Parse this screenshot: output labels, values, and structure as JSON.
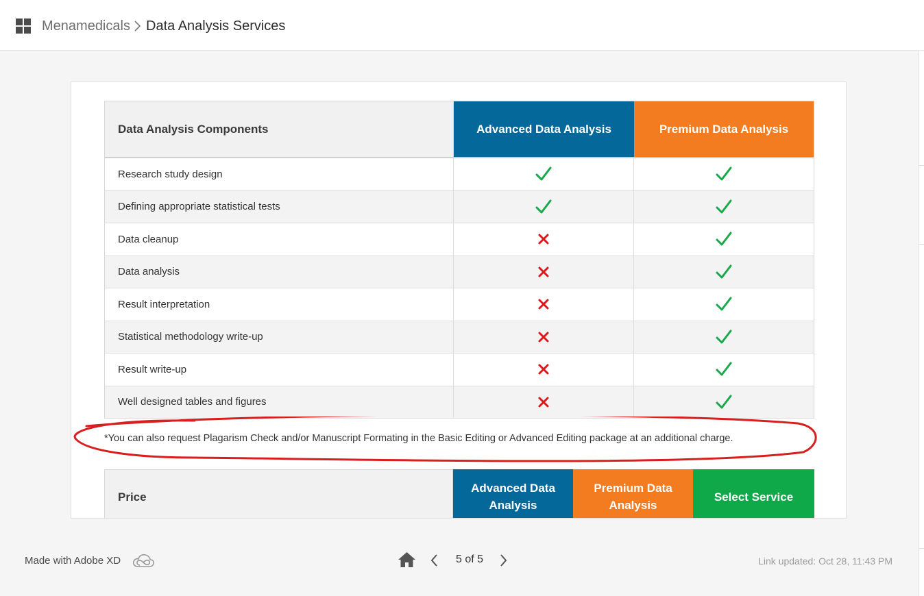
{
  "header": {
    "breadcrumb_root": "Menamedicals",
    "breadcrumb_current": "Data Analysis Services"
  },
  "comparison": {
    "header": {
      "components": "Data Analysis Components",
      "advanced": "Advanced Data Analysis",
      "premium": "Premium Data Analysis"
    },
    "rows": [
      {
        "label": "Research study design",
        "advanced": true,
        "premium": true
      },
      {
        "label": "Defining appropriate statistical tests",
        "advanced": true,
        "premium": true
      },
      {
        "label": "Data cleanup",
        "advanced": false,
        "premium": true
      },
      {
        "label": "Data analysis",
        "advanced": false,
        "premium": true
      },
      {
        "label": "Result interpretation",
        "advanced": false,
        "premium": true
      },
      {
        "label": "Statistical methodology write-up",
        "advanced": false,
        "premium": true
      },
      {
        "label": "Result write-up",
        "advanced": false,
        "premium": true
      },
      {
        "label": "Well designed tables and figures",
        "advanced": false,
        "premium": true
      }
    ]
  },
  "note": "*You can also request Plagarism Check and/or Manuscript Formating in the Basic Editing or Advanced Editing package at an additional charge.",
  "price_table": {
    "label": "Price",
    "advanced": "Advanced Data Analysis",
    "premium": "Premium Data Analysis",
    "select": "Select Service"
  },
  "footer": {
    "made_with": "Made with Adobe XD",
    "page_indicator": "5 of 5",
    "link_updated": "Link updated: Oct 28, 11:43 PM"
  },
  "colors": {
    "advanced_blue": "#04689a",
    "premium_orange": "#f47c20",
    "select_green": "#10a94a",
    "check_green": "#1aa84a",
    "cross_red": "#e0161b",
    "annotation_red": "#d81e1e"
  },
  "icons": {
    "apps": "grid-icon",
    "breadcrumb_separator": "chevron-right-icon",
    "included": "checkmark-icon",
    "excluded": "cross-icon",
    "creative_cloud": "creative-cloud-icon",
    "home": "home-icon",
    "previous": "chevron-left-icon",
    "next": "chevron-right-icon"
  }
}
